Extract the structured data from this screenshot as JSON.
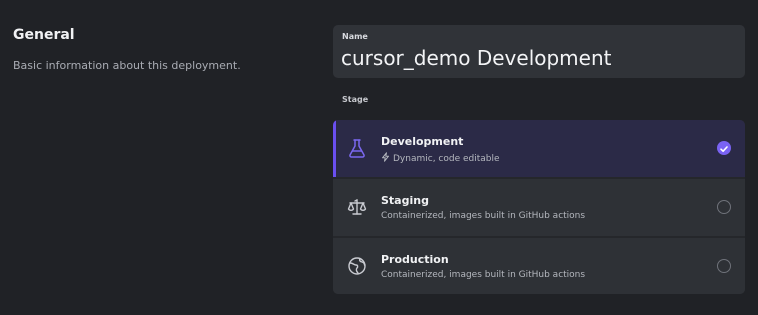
{
  "general": {
    "title": "General",
    "description": "Basic information about this deployment."
  },
  "name_field": {
    "label": "Name",
    "value": "cursor_demo Development"
  },
  "stage": {
    "label": "Stage",
    "options": [
      {
        "title": "Development",
        "subtitle": "Dynamic, code editable",
        "icon": "flask-icon",
        "sub_icon": "lightning-icon",
        "selected": true
      },
      {
        "title": "Staging",
        "subtitle": "Containerized, images built in GitHub actions",
        "icon": "scale-icon",
        "selected": false
      },
      {
        "title": "Production",
        "subtitle": "Containerized, images built in GitHub actions",
        "icon": "globe-icon",
        "selected": false
      }
    ]
  },
  "colors": {
    "accent": "#6a4ff0",
    "background": "#202226",
    "card": "#2e3136",
    "selected_card": "#2b2a47"
  }
}
